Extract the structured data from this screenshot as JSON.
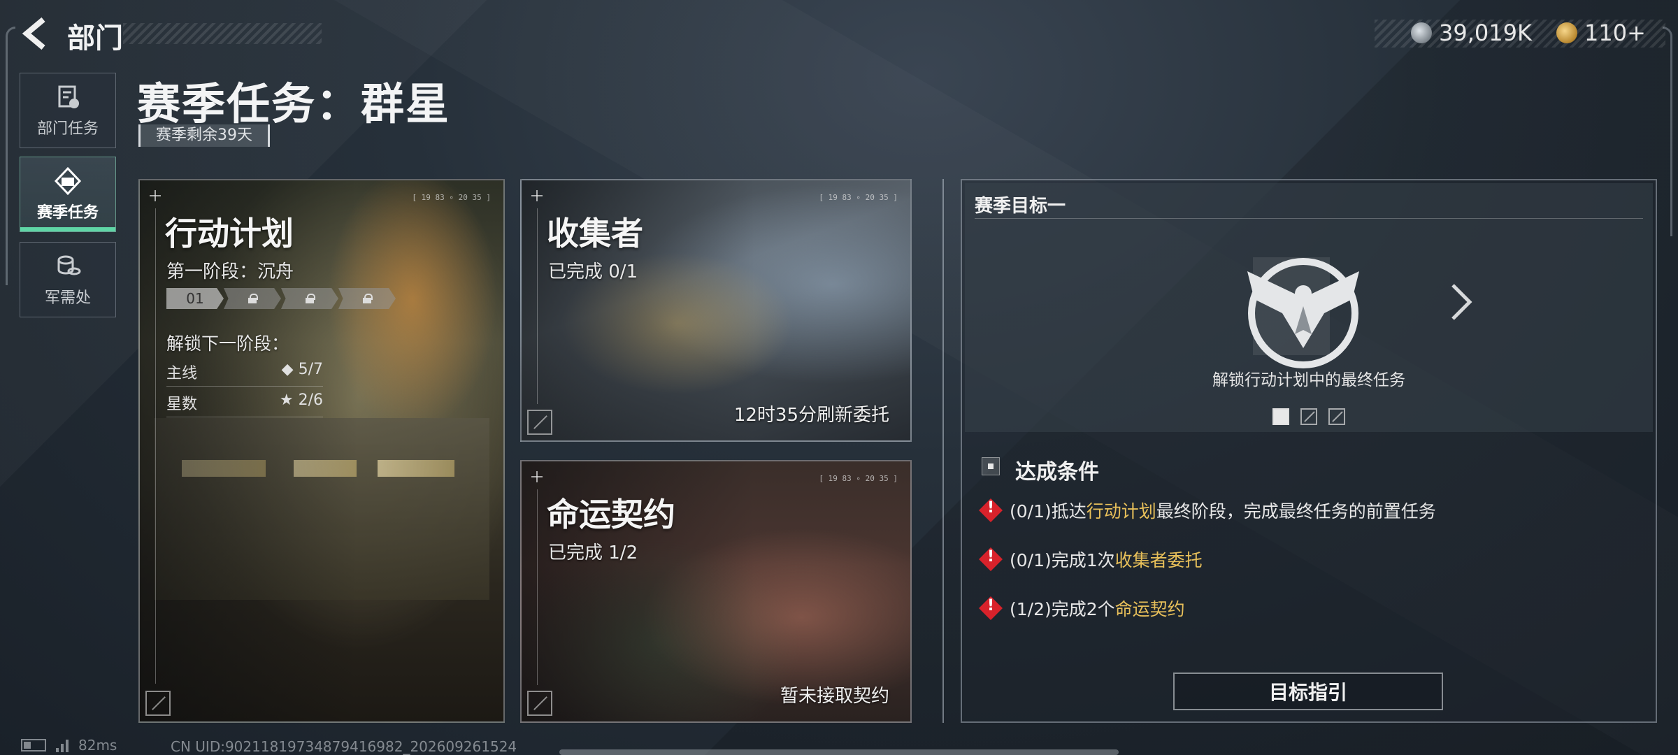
{
  "topbar": {
    "back_label": "部门",
    "currency1": "39,019K",
    "currency2": "110+"
  },
  "sidebar": {
    "items": [
      {
        "label": "部门任务",
        "icon": "document-icon"
      },
      {
        "label": "赛季任务",
        "icon": "season-icon",
        "active": true
      },
      {
        "label": "军需处",
        "icon": "coins-icon"
      }
    ]
  },
  "header": {
    "title": "赛季任务：群星",
    "season_remaining": "赛季剩余39天"
  },
  "cards": {
    "operation": {
      "title": "行动计划",
      "stage": "第一阶段：沉舟",
      "stages": [
        "01",
        "",
        "",
        ""
      ],
      "unlock_label": "解锁下一阶段：",
      "main_label": "主线",
      "main_value": "◆ 5/7",
      "star_label": "星数",
      "star_value": "★ 2/6",
      "corner": "[ 19 83 ∘ 20 35 ]"
    },
    "collector": {
      "title": "收集者",
      "progress": "已完成 0/1",
      "footer": "12时35分刷新委托",
      "corner": "[ 19 83 ∘ 20 35 ]"
    },
    "fate": {
      "title": "命运契约",
      "progress": "已完成 1/2",
      "footer": "暂未接取契约",
      "corner": "[ 19 83 ∘ 20 35 ]"
    }
  },
  "goal": {
    "title": "赛季目标一",
    "description": "解锁行动计划中的最终任务",
    "page_index": 0,
    "page_count": 3,
    "conditions_title": "达成条件",
    "conditions": [
      {
        "prefix": "(0/1)抵达",
        "highlight": "行动计划",
        "suffix": "最终阶段，完成最终任务的前置任务"
      },
      {
        "prefix": "(0/1)完成1次",
        "highlight": "收集者委托",
        "suffix": ""
      },
      {
        "prefix": "(1/2)完成2个",
        "highlight": "命运契约",
        "suffix": ""
      }
    ],
    "guide_button": "目标指引"
  },
  "status": {
    "ping": "82ms",
    "uid": "CN UID:90211819734879416982_202609261524"
  },
  "colors": {
    "accent": "#5fd6a6",
    "highlight": "#e8c05a",
    "warning": "#d8222b"
  }
}
